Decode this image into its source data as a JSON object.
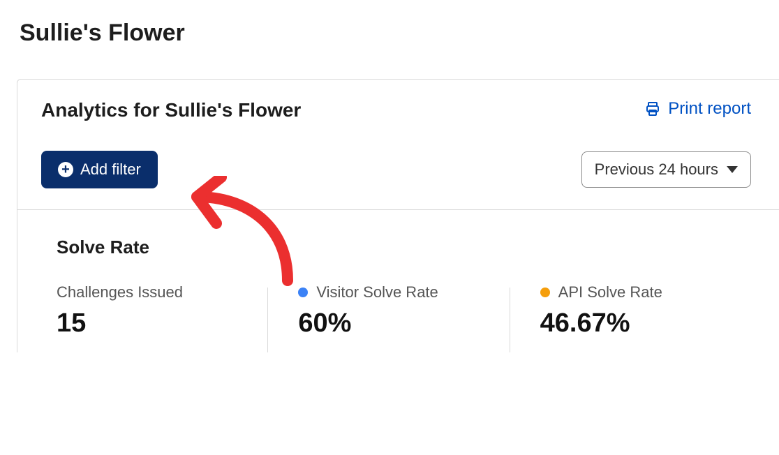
{
  "page": {
    "title": "Sullie's Flower"
  },
  "card": {
    "heading": "Analytics for Sullie's Flower",
    "print_label": "Print report",
    "add_filter_label": "Add filter",
    "time_range_label": "Previous 24 hours"
  },
  "solve_rate": {
    "section_title": "Solve Rate",
    "stats": [
      {
        "label": "Challenges Issued",
        "value": "15"
      },
      {
        "label": "Visitor Solve Rate",
        "value": "60%"
      },
      {
        "label": "API Solve Rate",
        "value": "46.67%"
      }
    ]
  }
}
